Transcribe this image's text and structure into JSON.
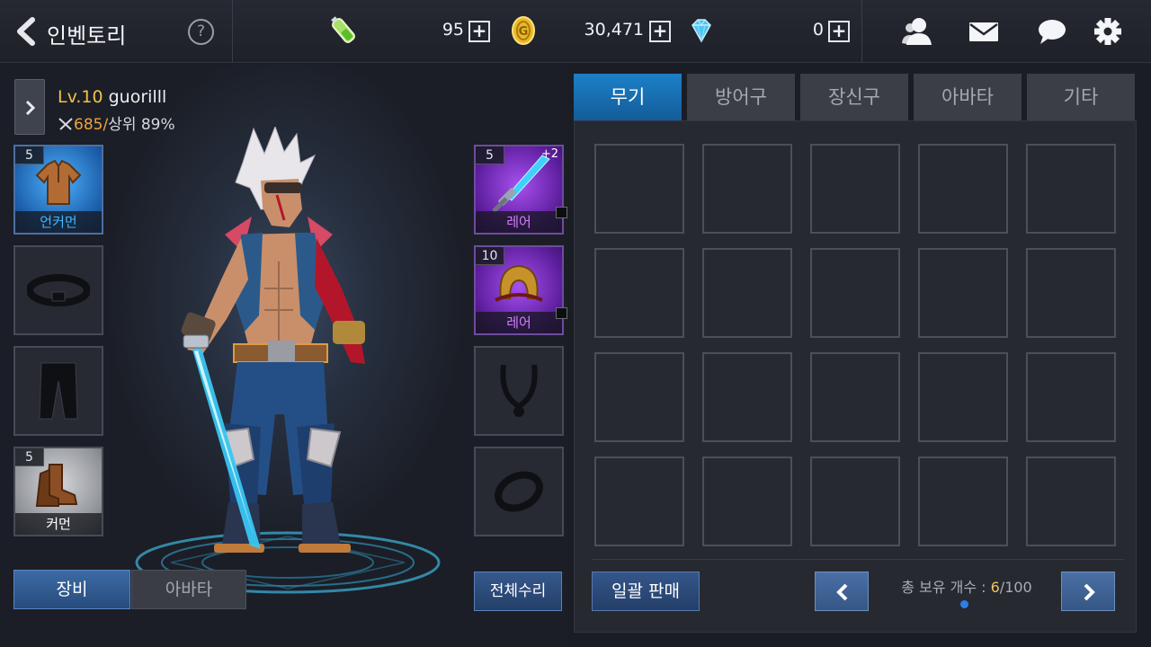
{
  "header": {
    "title": "인벤토리",
    "help_label": "?",
    "stamina": "95",
    "gold": "30,471",
    "gems": "0",
    "plus_label": "+",
    "icons": [
      "stamina-icon",
      "gold-coin-icon",
      "diamond-icon",
      "friends-icon",
      "mail-icon",
      "chat-icon",
      "settings-icon"
    ]
  },
  "character": {
    "level": "Lv.10",
    "name": "guorilll",
    "power": "685/",
    "rank": "상위 89%"
  },
  "equip_left": [
    {
      "level": "5",
      "grade": "언커먼",
      "grade_color": "#3fb6ff",
      "icon": "shirt-icon"
    },
    {
      "level": "",
      "grade": "",
      "icon": "belt-icon"
    },
    {
      "level": "",
      "grade": "",
      "icon": "pants-icon"
    },
    {
      "level": "5",
      "grade": "커먼",
      "grade_color": "#ffffff",
      "icon": "boots-icon"
    }
  ],
  "equip_right": [
    {
      "level": "5",
      "enhance": "+2",
      "grade": "레어",
      "grade_color": "#d37bff",
      "icon": "sword-icon"
    },
    {
      "level": "10",
      "grade": "레어",
      "grade_color": "#d37bff",
      "icon": "shoulder-armor-icon"
    },
    {
      "level": "",
      "grade": "",
      "icon": "necklace-icon"
    },
    {
      "level": "",
      "grade": "",
      "icon": "ring-icon"
    }
  ],
  "buttons": {
    "equip": "장비",
    "avatar": "아바타",
    "repair_all": "전체수리",
    "bulk_sell": "일괄 판매"
  },
  "tabs": [
    "무기",
    "방어구",
    "장신구",
    "아바타",
    "기타"
  ],
  "active_tab": 0,
  "inventory": {
    "count_label": "총 보유 개수 : ",
    "count_current": "6",
    "count_max": "/100"
  },
  "colors": {
    "accent_blue": "#1d80c8",
    "level_gold": "#f2c14a",
    "power_orange": "#f0a340",
    "rare_purple": "#d37bff",
    "uncommon_blue": "#3fb6ff"
  }
}
